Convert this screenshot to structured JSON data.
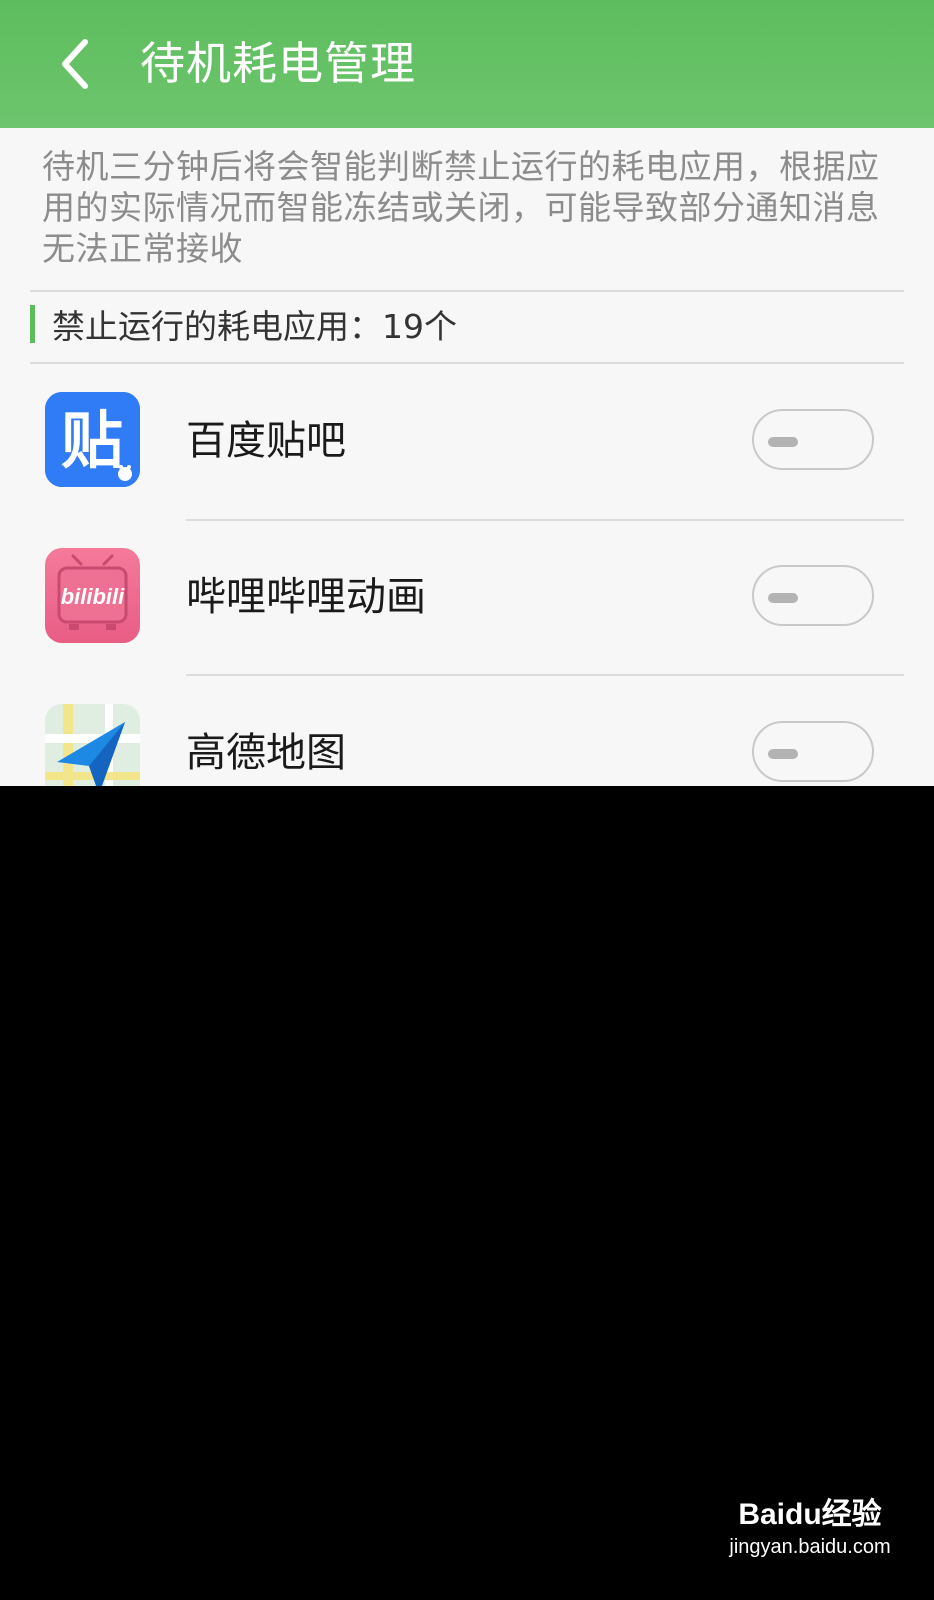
{
  "header": {
    "back_icon": "chevron-left-icon",
    "title": "待机耗电管理",
    "background_color": "#5dbd5d"
  },
  "description": "待机三分钟后将会智能判断禁止运行的耗电应用，根据应用的实际情况而智能冻结或关闭，可能导致部分通知消息无法正常接收",
  "section": {
    "title": "禁止运行的耗电应用：19个",
    "accent_color": "#5dbd5d"
  },
  "apps": [
    {
      "name": "百度贴吧",
      "icon": "baidu-tieba-icon",
      "icon_text": "贴",
      "toggle_on": false
    },
    {
      "name": "哔哩哔哩动画",
      "icon": "bilibili-icon",
      "icon_text": "bilibili",
      "toggle_on": false
    },
    {
      "name": "高德地图",
      "icon": "amap-icon",
      "toggle_on": false
    }
  ],
  "watermark": {
    "logo_text": "Baidu经验",
    "url": "jingyan.baidu.com"
  }
}
